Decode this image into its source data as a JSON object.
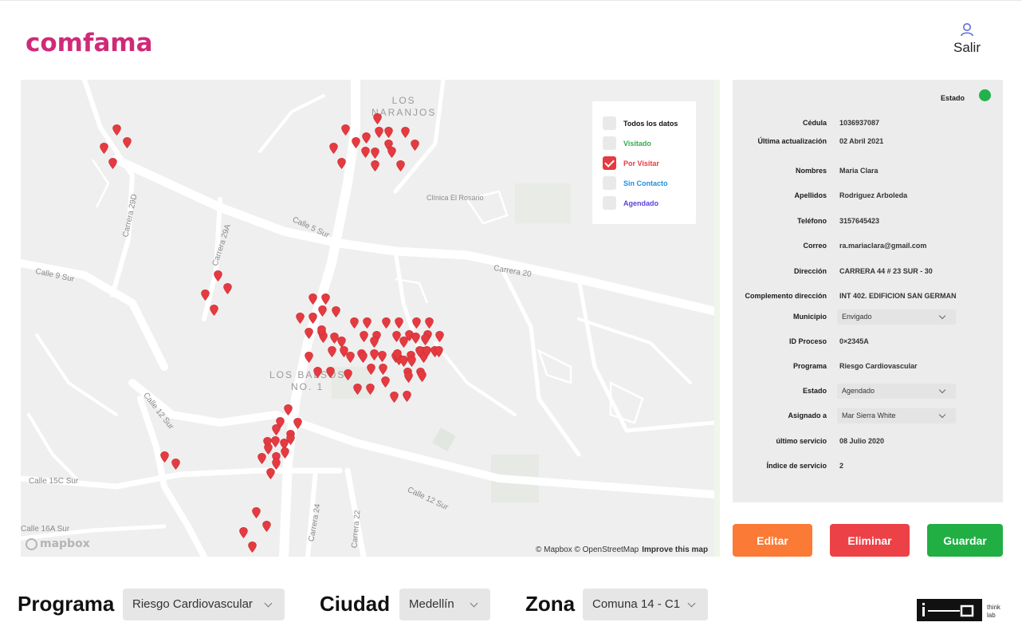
{
  "header": {
    "logo_text": "comfama",
    "user_label": "Salir"
  },
  "map": {
    "streets": [
      "Calle 9 Sur",
      "Calle 12 Sur",
      "Calle 15C Sur",
      "Calle 16A Sur",
      "Calle 12 Sur",
      "Carrera 20",
      "Carrera 24",
      "Carrera 22",
      "Carrera 29D",
      "Carrera 29A",
      "Calle 5 Sur"
    ],
    "areas": [
      "LOS\nNARANJOS",
      "LOS BALSOS\nNO. 1"
    ],
    "poi": "Clínica El Rosario",
    "legend": [
      {
        "label": "Todos los datos",
        "checked": false,
        "color": "#111111"
      },
      {
        "label": "Visitado",
        "checked": false,
        "color": "#2fae4e"
      },
      {
        "label": "Por Visitar",
        "checked": true,
        "color": "#e53a40"
      },
      {
        "label": "Sin Contacto",
        "checked": false,
        "color": "#1d8fe0"
      },
      {
        "label": "Agendado",
        "checked": false,
        "color": "#5a3fe0"
      }
    ],
    "marker_color": "#e53a40",
    "attribution": "© Mapbox © OpenStreetMap",
    "improve": "Improve this map",
    "logo": "mapbox"
  },
  "detail": {
    "estado_label": "Estado",
    "estado_color": "#21b24b",
    "fields": [
      {
        "label": "Cédula",
        "value": "1036937087"
      },
      {
        "label": "Última actualización",
        "value": "02 Abril 2021"
      },
      {
        "label": "Nombres",
        "value": "Maria Clara"
      },
      {
        "label": "Apellidos",
        "value": "Rodriguez Arboleda"
      },
      {
        "label": "Teléfono",
        "value": "3157645423"
      },
      {
        "label": "Correo",
        "value": "ra.mariaclara@gmail.com"
      },
      {
        "label": "Dirección",
        "value": "CARRERA 44 # 23 SUR - 30"
      },
      {
        "label": "Complemento dirección",
        "value": "INT 402. EDIFICION SAN GERMAN"
      },
      {
        "label": "Municipio",
        "value": "Envigado",
        "select": true
      },
      {
        "label": "ID Proceso",
        "value": "0×2345A"
      },
      {
        "label": "Programa",
        "value": "Riesgo Cardiovascular"
      },
      {
        "label": "Estado",
        "value": "Agendado",
        "select": true
      },
      {
        "label": "Asignado a",
        "value": "Mar Sierra White",
        "select": true
      },
      {
        "label": "último servicio",
        "value": "08 Julio 2020"
      },
      {
        "label": "Índice de servicio",
        "value": "2"
      }
    ]
  },
  "actions": {
    "edit": "Editar",
    "delete": "Eliminar",
    "save": "Guardar"
  },
  "filters": {
    "programa_label": "Programa",
    "programa_value": "Riesgo Cardiovascular",
    "ciudad_label": "Ciudad",
    "ciudad_value": "Medellín",
    "zona_label": "Zona",
    "zona_value": "Comuna 14 - C1"
  },
  "brand": {
    "text_line1": "think",
    "text_line2": "lab"
  }
}
